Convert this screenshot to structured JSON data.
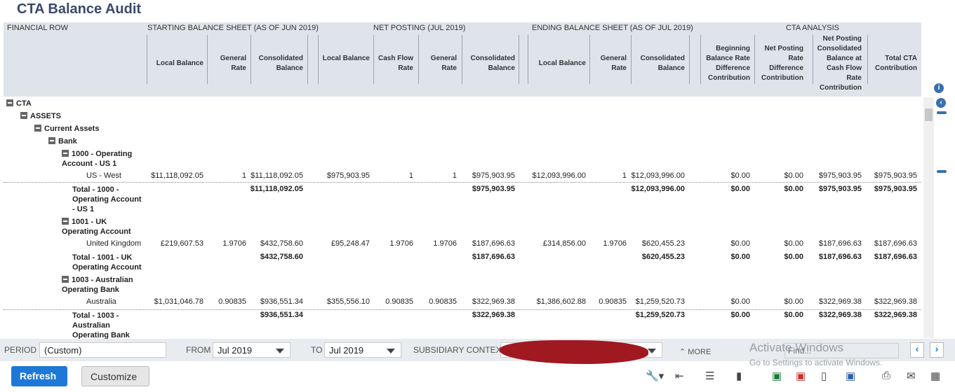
{
  "page": {
    "title": "CTA Balance Audit"
  },
  "header": {
    "groups": {
      "financial_row": "FINANCIAL ROW",
      "starting": "STARTING BALANCE SHEET (AS OF JUN 2019)",
      "net": "NET POSTING (JUL 2019)",
      "ending": "ENDING BALANCE SHEET (AS OF JUL 2019)",
      "cta": "CTA ANALYSIS"
    },
    "cols": [
      "Local Balance",
      "General Rate",
      "Consolidated Balance",
      "Local Balance",
      "Cash Flow Rate",
      "General Rate",
      "Consolidated Balance",
      "Local Balance",
      "General Rate",
      "Consolidated Balance",
      "Beginning Balance Rate Difference Contribution",
      "Net Posting Rate Difference Contribution",
      "Net Posting Consolidated Balance at Cash Flow Rate Contribution",
      "Total CTA Contribution"
    ]
  },
  "tree": {
    "cta": "CTA",
    "assets": "ASSETS",
    "current_assets": "Current Assets",
    "bank": "Bank",
    "acct1000": "1000 - Operating Account - US 1",
    "acct1001": "1001 - UK Operating Account",
    "acct1003": "1003 - Australian Operating Bank"
  },
  "rows": [
    {
      "label": "US - West",
      "vals": [
        "$11,118,092.05",
        "1",
        "$11,118,092.05",
        "$975,903.95",
        "1",
        "1",
        "$975,903.95",
        "$12,093,996.00",
        "1",
        "$12,093,996.00",
        "$0.00",
        "$0.00",
        "$975,903.95",
        "$975,903.95"
      ]
    },
    {
      "label": "Total - 1000 - Operating Account - US 1",
      "vals": [
        "",
        "",
        "$11,118,092.05",
        "",
        "",
        "",
        "$975,903.95",
        "",
        "",
        "$12,093,996.00",
        "$0.00",
        "$0.00",
        "$975,903.95",
        "$975,903.95"
      ]
    },
    {
      "label": "United Kingdom",
      "vals": [
        "£219,607.53",
        "1.9706",
        "$432,758.60",
        "£95,248.47",
        "1.9706",
        "1.9706",
        "$187,696.63",
        "£314,856.00",
        "1.9706",
        "$620,455.23",
        "$0.00",
        "$0.00",
        "$187,696.63",
        "$187,696.63"
      ]
    },
    {
      "label": "Total - 1001 - UK Operating Account",
      "vals": [
        "",
        "",
        "$432,758.60",
        "",
        "",
        "",
        "$187,696.63",
        "",
        "",
        "$620,455.23",
        "$0.00",
        "$0.00",
        "$187,696.63",
        "$187,696.63"
      ]
    },
    {
      "label": "Australia",
      "vals": [
        "$1,031,046.78",
        "0.90835",
        "$936,551.34",
        "$355,556.10",
        "0.90835",
        "0.90835",
        "$322,969.38",
        "$1,386,602.88",
        "0.90835",
        "$1,259,520.73",
        "$0.00",
        "$0.00",
        "$322,969.38",
        "$322,969.38"
      ]
    },
    {
      "label": "Total - 1003 - Australian Operating Bank",
      "vals": [
        "",
        "",
        "$936,551.34",
        "",
        "",
        "",
        "$322,969.38",
        "",
        "",
        "$1,259,520.73",
        "$0.00",
        "$0.00",
        "$322,969.38",
        "$322,969.38"
      ]
    }
  ],
  "filters": {
    "period_label": "PERIOD",
    "period_value": "(Custom)",
    "from_label": "FROM",
    "from_value": "Jul 2019",
    "to_label": "TO",
    "to_value": "Jul 2019",
    "subsidiary_label": "SUBSIDIARY CONTEXT",
    "more_label": "MORE",
    "find_placeholder": "Find..."
  },
  "watermark": {
    "line1": "Activate Windows",
    "line2": "Go to Settings to activate Windows."
  },
  "buttons": {
    "refresh": "Refresh",
    "customize": "Customize"
  },
  "colors": {
    "accent": "#1e78d7",
    "header_bg": "#dfe4eb",
    "redaction": "#a01820"
  }
}
